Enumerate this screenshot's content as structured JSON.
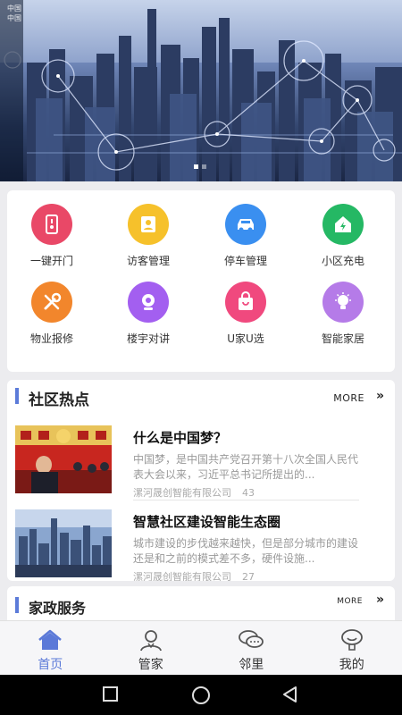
{
  "status_overlay": [
    "中国",
    "中国"
  ],
  "banner": {
    "alt": "smart city skyline"
  },
  "grid": [
    {
      "label": "一键开门",
      "icon": "door-icon",
      "color": "#e94867"
    },
    {
      "label": "访客管理",
      "icon": "visitor-icon",
      "color": "#f6c12b"
    },
    {
      "label": "停车管理",
      "icon": "car-icon",
      "color": "#3a8ff0"
    },
    {
      "label": "小区充电",
      "icon": "charge-icon",
      "color": "#25b864"
    },
    {
      "label": "物业报修",
      "icon": "repair-icon",
      "color": "#f2862c"
    },
    {
      "label": "楼宇对讲",
      "icon": "camera-icon",
      "color": "#a35ff0"
    },
    {
      "label": "U家U选",
      "icon": "bag-icon",
      "color": "#f0497e"
    },
    {
      "label": "智能家居",
      "icon": "bulb-icon",
      "color": "#b57be8"
    }
  ],
  "news_section": {
    "title": "社区热点",
    "more": "MORE",
    "more_arrow": "»",
    "items": [
      {
        "title": "什么是中国梦？",
        "desc": "中国梦，是中国共产党召开第十八次全国人民代表大会以来，习近平总书记所提出的...",
        "source": "漯河晟创智能有限公司",
        "count": "43"
      },
      {
        "title": "智慧社区建设智能生态圈",
        "desc": "城市建设的步伐越来越快，但是部分城市的建设还是和之前的模式差不多，硬件设施...",
        "source": "漯河晟创智能有限公司",
        "count": "27"
      }
    ]
  },
  "service_section": {
    "title": "家政服务",
    "more": "MORE",
    "more_arrow": "»"
  },
  "tabs": [
    {
      "label": "首页",
      "icon": "home-icon",
      "active": true
    },
    {
      "label": "管家",
      "icon": "butler-icon",
      "active": false
    },
    {
      "label": "邻里",
      "icon": "chat-icon",
      "active": false
    },
    {
      "label": "我的",
      "icon": "profile-icon",
      "active": false
    }
  ],
  "colors": {
    "accent": "#5b79d8",
    "section_bar": "#5c7bd9"
  }
}
